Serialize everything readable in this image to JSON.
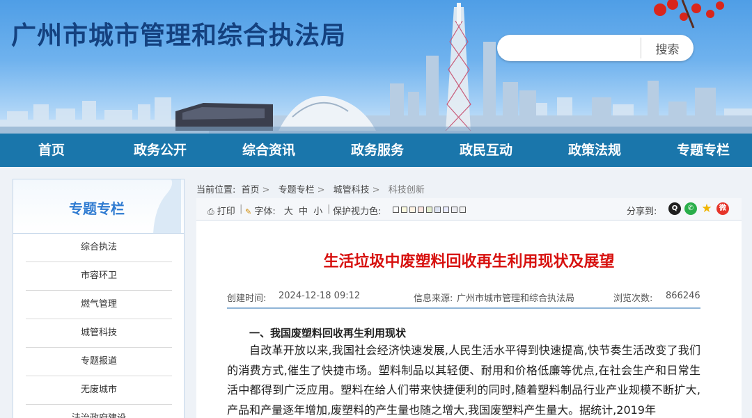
{
  "header": {
    "site_title": "广州市城市管理和综合执法局",
    "search_placeholder": "",
    "search_button": "搜索"
  },
  "nav": [
    "首页",
    "政务公开",
    "综合资讯",
    "政务服务",
    "政民互动",
    "政策法规",
    "专题专栏"
  ],
  "sidebar": {
    "title": "专题专栏",
    "items": [
      "综合执法",
      "市容环卫",
      "燃气管理",
      "城管科技",
      "专题报道",
      "无废城市",
      "法治政府建设"
    ]
  },
  "breadcrumb": {
    "prefix": "当前位置:",
    "items": [
      "首页",
      "专题专栏",
      "城管科技",
      "科技创新"
    ]
  },
  "toolbar": {
    "print": "打印",
    "font_label": "字体:",
    "font_large": "大",
    "font_medium": "中",
    "font_small": "小",
    "eye_label": "保护视力色:",
    "share_label": "分享到:",
    "eye_colors": [
      "#ffffff",
      "#faf9de",
      "#fff2e2",
      "#fde6e0",
      "#e3edcd",
      "#dce2f1",
      "#e9ebfe",
      "#eaeaef",
      "#f2f2f2"
    ],
    "share_icons": [
      "qq-icon",
      "wechat-icon",
      "qzone-icon",
      "weibo-icon"
    ]
  },
  "article": {
    "title": "生活垃圾中废塑料回收再生利用现状及展望",
    "created_label": "创建时间:",
    "created": "2024-12-18 09:12",
    "source_label": "信息来源:",
    "source": "广州市城市管理和综合执法局",
    "views_label": "浏览次数:",
    "views": "866246",
    "section1": "一、我国废塑料回收再生利用现状",
    "paragraph1": "自改革开放以来,我国社会经济快速发展,人民生活水平得到快速提高,快节奏生活改变了我们的消费方式,催生了快捷市场。塑料制品以其轻便、耐用和价格低廉等优点,在社会生产和日常生活中都得到广泛应用。塑料在给人们带来快捷便利的同时,随着塑料制品行业产业规模不断扩大,产品和产量逐年增加,废塑料的产生量也随之增大,我国废塑料产生量大。据统计,2019年"
  },
  "colors": {
    "nav_bg": "#1a76ab",
    "title_red": "#d7110f",
    "sidebar_title": "#2f7bd1"
  }
}
